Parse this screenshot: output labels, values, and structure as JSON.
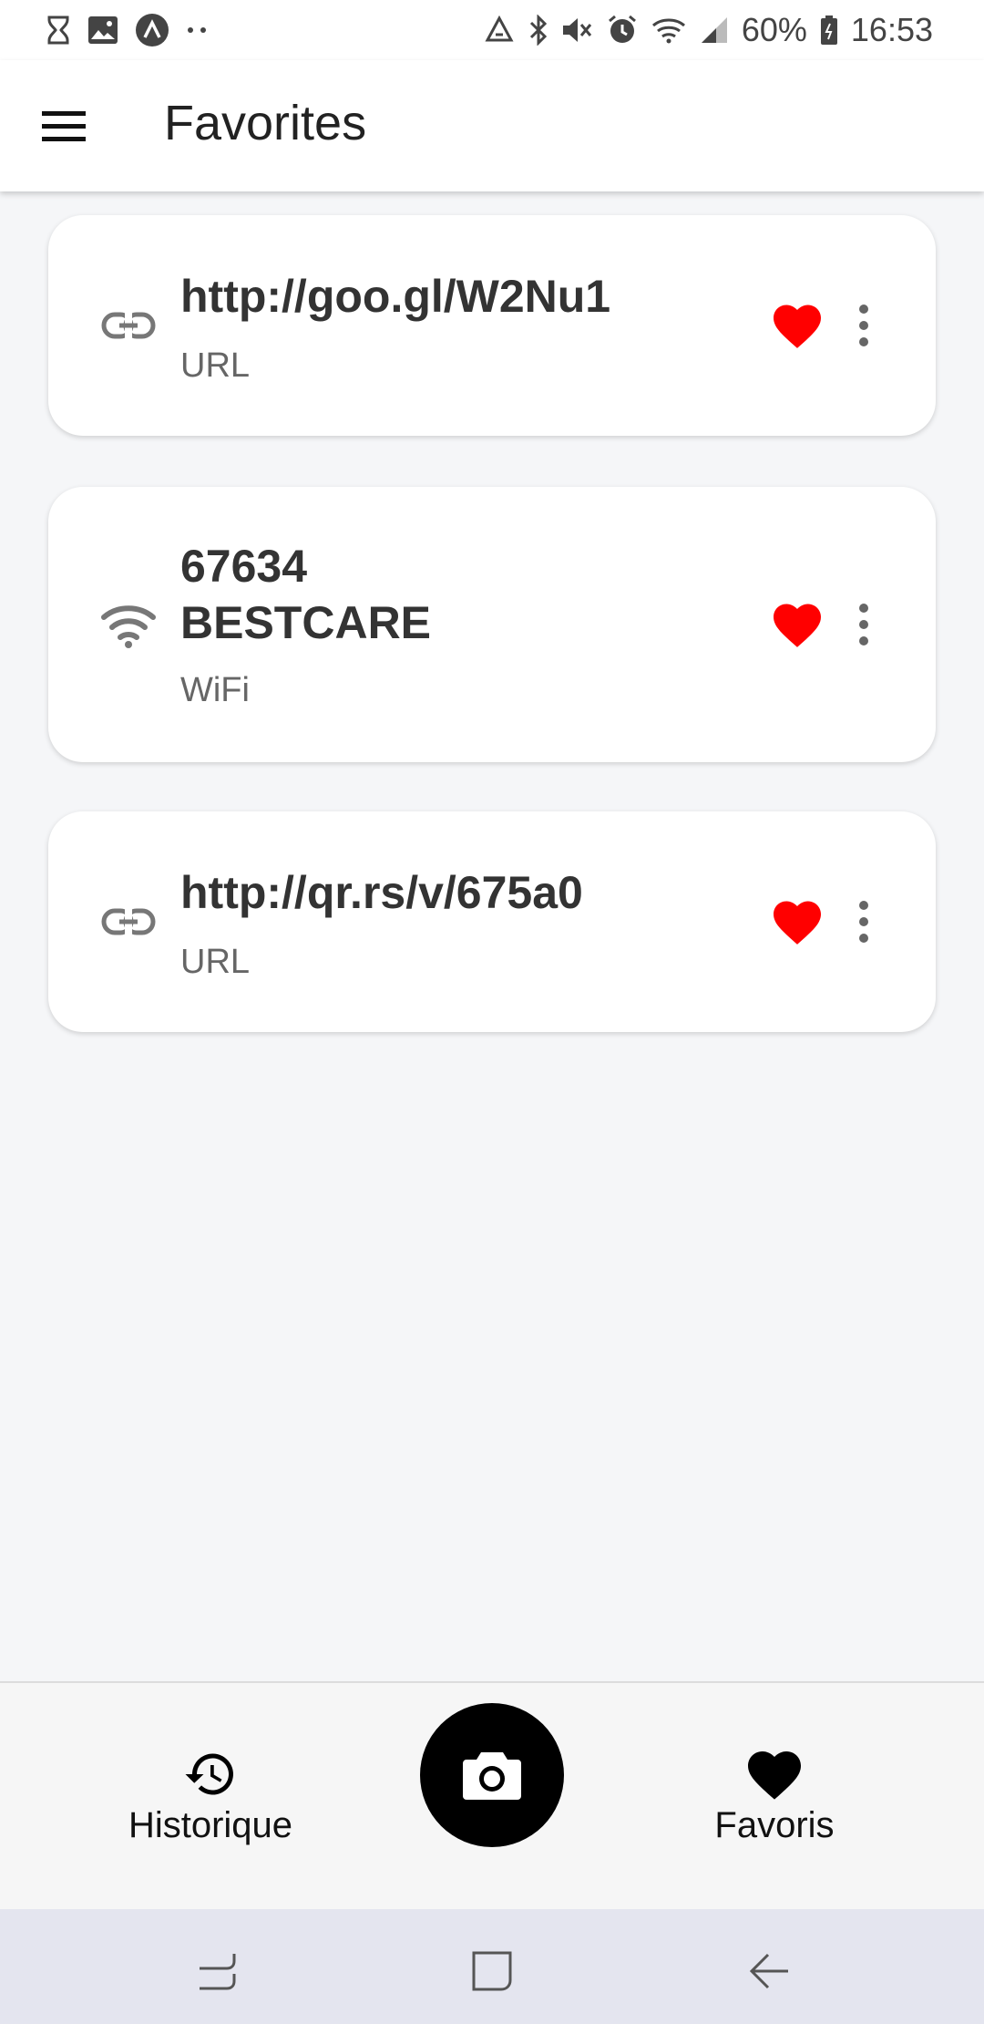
{
  "status_bar": {
    "left_icons": [
      "hourglass-icon",
      "image-icon",
      "app-icon",
      "more-dots-icon"
    ],
    "right_icons": [
      "recycle-icon",
      "bluetooth-icon",
      "mute-icon",
      "alarm-icon",
      "wifi-icon",
      "signal-icon"
    ],
    "battery": "60%",
    "time": "16:53"
  },
  "app_bar": {
    "title": "Favorites",
    "menu_icon": "menu-icon"
  },
  "favorites": [
    {
      "type_icon": "link-icon",
      "title": "http://goo.gl/W2Nu1",
      "subtitle": "URL",
      "favorite": true
    },
    {
      "type_icon": "wifi-icon",
      "title_lines": [
        "67634",
        "BESTCARE"
      ],
      "subtitle": "WiFi",
      "favorite": true
    },
    {
      "type_icon": "link-icon",
      "title": "http://qr.rs/v/675a0",
      "subtitle": "URL",
      "favorite": true
    }
  ],
  "bottom_nav": {
    "history_label": "Historique",
    "history_icon": "history-icon",
    "camera_icon": "camera-icon",
    "favorites_label": "Favoris",
    "favorites_icon": "heart-icon"
  },
  "colors": {
    "heart": "#ff0000",
    "camera_button": "#000000",
    "background": "#f5f6f8",
    "system_nav": "#e4e5ef"
  },
  "system_nav": {
    "icons": [
      "recents-icon",
      "home-icon",
      "back-icon"
    ]
  }
}
